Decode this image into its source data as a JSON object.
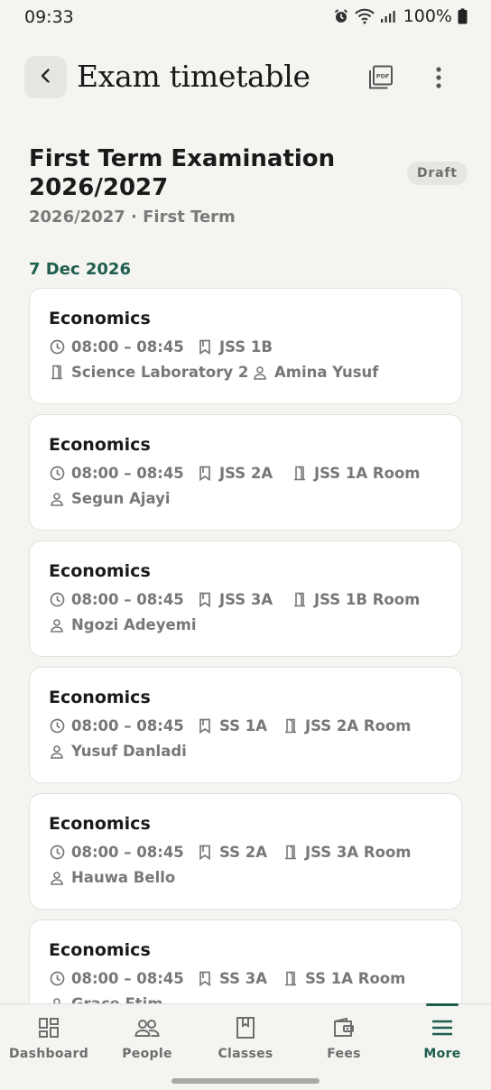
{
  "status_bar": {
    "time": "09:33",
    "battery": "100%"
  },
  "app_bar": {
    "title": "Exam timetable",
    "pdf_icon_text": "PDF"
  },
  "exam": {
    "title": "First Term Examination 2026/2027",
    "subtitle": "2026/2027 · First Term",
    "status_badge": "Draft"
  },
  "date_heading": "7 Dec 2026",
  "entries": [
    {
      "subject": "Economics",
      "time": "08:00 – 08:45",
      "class": "JSS 1B",
      "room": "Science Laboratory 2",
      "teacher": "Amina Yusuf"
    },
    {
      "subject": "Economics",
      "time": "08:00 – 08:45",
      "class": "JSS 2A",
      "room": "JSS 1A Room",
      "teacher": "Segun Ajayi"
    },
    {
      "subject": "Economics",
      "time": "08:00 – 08:45",
      "class": "JSS 3A",
      "room": "JSS 1B Room",
      "teacher": "Ngozi Adeyemi"
    },
    {
      "subject": "Economics",
      "time": "08:00 – 08:45",
      "class": "SS 1A",
      "room": "JSS 2A Room",
      "teacher": "Yusuf Danladi"
    },
    {
      "subject": "Economics",
      "time": "08:00 – 08:45",
      "class": "SS 2A",
      "room": "JSS 3A Room",
      "teacher": "Hauwa Bello"
    },
    {
      "subject": "Economics",
      "time": "08:00 – 08:45",
      "class": "SS 3A",
      "room": "SS 1A Room",
      "teacher": "Grace Etim"
    }
  ],
  "bottom_nav": {
    "items": [
      {
        "label": "Dashboard",
        "icon": "dashboard-icon"
      },
      {
        "label": "People",
        "icon": "people-icon"
      },
      {
        "label": "Classes",
        "icon": "bookmark-icon"
      },
      {
        "label": "Fees",
        "icon": "wallet-icon"
      },
      {
        "label": "More",
        "icon": "menu-icon"
      }
    ],
    "active": "More"
  },
  "colors": {
    "accent": "#1e5e4f",
    "background": "#f4f4f1",
    "card": "#ffffff",
    "muted_text": "#777777"
  }
}
